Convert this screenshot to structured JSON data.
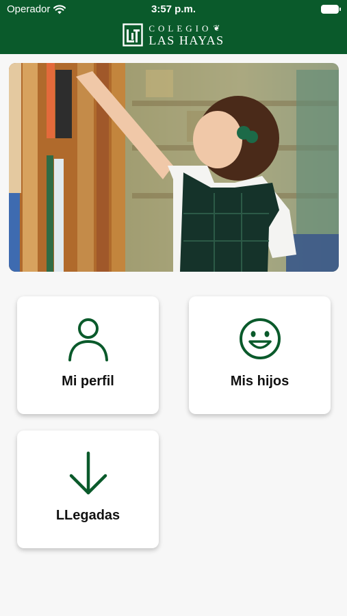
{
  "status_bar": {
    "carrier": "Operador",
    "time": "3:57 p.m."
  },
  "header": {
    "logo_line1": "COLEGIO",
    "logo_line2": "LAS HAYAS",
    "brand_color": "#0a5a2b"
  },
  "hero": {
    "icon": "school-library-photo"
  },
  "menu": {
    "items": [
      {
        "label": "Mi perfil",
        "icon": "person-icon"
      },
      {
        "label": "Mis hijos",
        "icon": "smiley-icon"
      },
      {
        "label": "LLegadas",
        "icon": "arrow-down-icon"
      }
    ]
  },
  "colors": {
    "accent": "#0a5a2b",
    "background": "#f7f7f7",
    "card": "#ffffff"
  }
}
